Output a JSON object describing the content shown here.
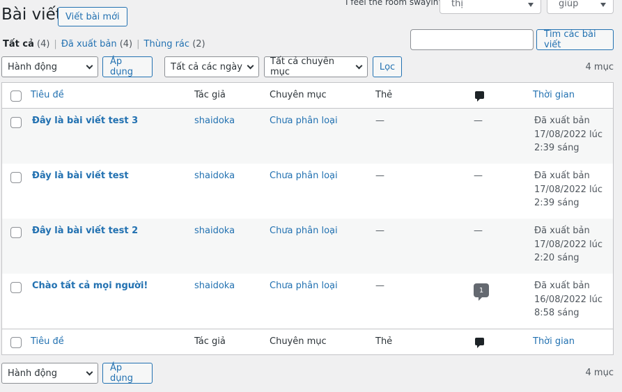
{
  "header": {
    "note_text": "I feel the room swayin'",
    "screen_options_label": "Tùy chọn hiển thị",
    "help_label": "Trợ giúp",
    "page_title": "Bài viết",
    "add_new_label": "Viết bài mới"
  },
  "filters": {
    "views": [
      {
        "label": "Tất cả",
        "count": "(4)"
      },
      {
        "label": "Đã xuất bản",
        "count": "(4)"
      },
      {
        "label": "Thùng rác",
        "count": "(2)"
      }
    ],
    "search_placeholder": "",
    "search_button_label": "Tìm các bài viết",
    "bulk_action_label": "Hành động",
    "apply_label": "Áp dụng",
    "dates_label": "Tất cả các ngày",
    "categories_label": "Tất cả chuyên mục",
    "filter_button_label": "Lọc",
    "items_count": "4 mục"
  },
  "table": {
    "columns": {
      "title": "Tiêu đề",
      "author": "Tác giả",
      "categories": "Chuyên mục",
      "tags": "Thẻ",
      "date": "Thời gian"
    },
    "rows": [
      {
        "title": "Đây là bài viết test 3",
        "author": "shaidoka",
        "category": "Chưa phân loại",
        "tags": "—",
        "comments": "—",
        "status": "Đã xuất bản",
        "date": "17/08/2022 lúc",
        "time": "2:39 sáng"
      },
      {
        "title": "Đây là bài viết test",
        "author": "shaidoka",
        "category": "Chưa phân loại",
        "tags": "—",
        "comments": "—",
        "status": "Đã xuất bản",
        "date": "17/08/2022 lúc",
        "time": "2:39 sáng"
      },
      {
        "title": "Đây là bài viết test 2",
        "author": "shaidoka",
        "category": "Chưa phân loại",
        "tags": "—",
        "comments": "—",
        "status": "Đã xuất bản",
        "date": "17/08/2022 lúc",
        "time": "2:20 sáng"
      },
      {
        "title": "Chào tất cả mọi người!",
        "author": "shaidoka",
        "category": "Chưa phân loại",
        "tags": "—",
        "comments": "1",
        "status": "Đã xuất bản",
        "date": "16/08/2022 lúc",
        "time": "8:58 sáng"
      }
    ]
  },
  "bottom": {
    "bulk_action_label": "Hành động",
    "apply_label": "Áp dụng",
    "items_count": "4 mục"
  }
}
